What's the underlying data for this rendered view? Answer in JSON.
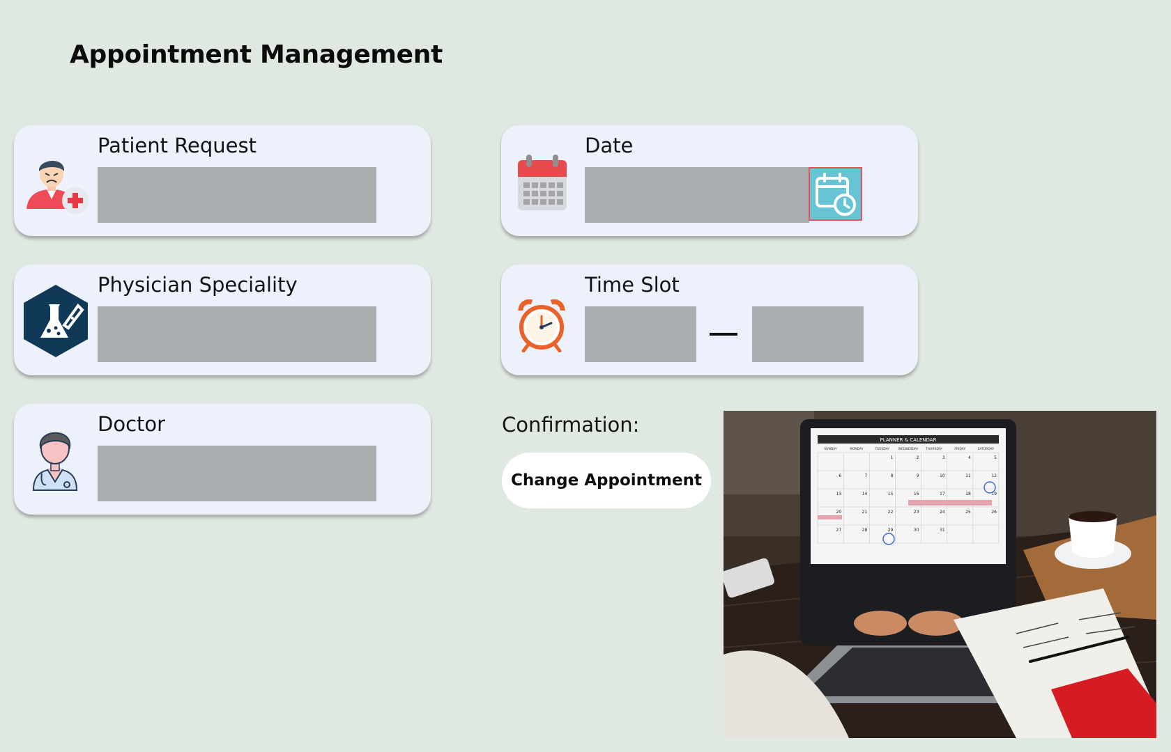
{
  "page": {
    "title": "Appointment Management"
  },
  "fields": {
    "patient_request": {
      "label": "Patient Request",
      "value": ""
    },
    "physician_speciality": {
      "label": "Physician Speciality",
      "value": ""
    },
    "doctor": {
      "label": "Doctor",
      "value": ""
    },
    "date": {
      "label": "Date",
      "value": ""
    },
    "time_slot": {
      "label": "Time Slot",
      "start": "",
      "end": ""
    }
  },
  "confirmation": {
    "label": "Confirmation:",
    "change_button": "Change Appointment"
  },
  "planner_photo": {
    "heading": "PLANNER & CALENDAR",
    "days": [
      "SUNDAY",
      "MONDAY",
      "TUESDAY",
      "WEDNESDAY",
      "THURSDAY",
      "FRIDAY",
      "SATURDAY"
    ],
    "dates": [
      "1",
      "2",
      "3",
      "4",
      "5",
      "6",
      "7",
      "8",
      "9",
      "10",
      "11",
      "12",
      "13",
      "14",
      "15",
      "16",
      "17",
      "18",
      "19",
      "20",
      "21",
      "22",
      "23",
      "24",
      "25",
      "26",
      "27",
      "28",
      "29",
      "30",
      "31"
    ]
  },
  "icons": {
    "patient": "sick-patient-icon",
    "speciality": "lab-flask-icon",
    "doctor": "doctor-icon",
    "date": "calendar-icon",
    "date_picker": "calendar-clock-icon",
    "time": "alarm-clock-icon"
  },
  "colors": {
    "background": "#e0e9e1",
    "card": "#edf1fc",
    "field": "#abafb2",
    "picker": "#66c4d4",
    "picker_border": "#e4565e",
    "navy_hex": "#0f3957"
  }
}
